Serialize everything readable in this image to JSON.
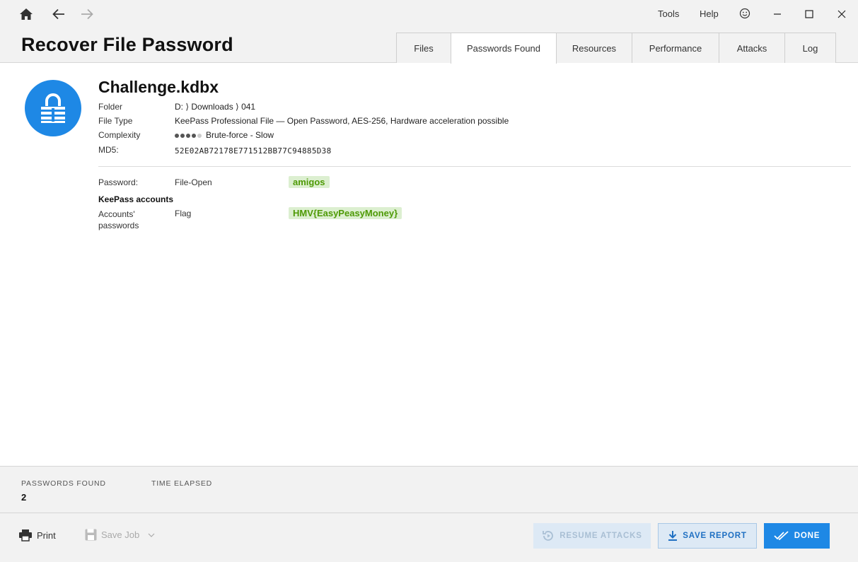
{
  "app": {
    "title": "Recover File Password"
  },
  "menu": {
    "tools": "Tools",
    "help": "Help"
  },
  "tabs": [
    {
      "label": "Files",
      "active": false
    },
    {
      "label": "Passwords Found",
      "active": true
    },
    {
      "label": "Resources",
      "active": false
    },
    {
      "label": "Performance",
      "active": false
    },
    {
      "label": "Attacks",
      "active": false
    },
    {
      "label": "Log",
      "active": false
    }
  ],
  "file": {
    "name": "Challenge.kdbx",
    "icon": "lock-icon",
    "folder_label": "Folder",
    "folder_value": "D: ⟩ Downloads ⟩ 041",
    "type_label": "File Type",
    "type_value": "KeePass Professional File — Open Password, AES-256, Hardware acceleration possible",
    "complexity_label": "Complexity",
    "complexity_level": 4,
    "complexity_max": 5,
    "complexity_value": "Brute-force - Slow",
    "md5_label": "MD5:",
    "md5_value": "52E02AB72178E771512BB77C94885D38"
  },
  "passwords": {
    "row1": {
      "label": "Password:",
      "field": "File-Open",
      "value": "amigos"
    },
    "section_heading": "KeePass accounts",
    "row2": {
      "label": "Accounts' passwords",
      "field": "Flag",
      "value": "HMV{EasyPeasyMoney}"
    }
  },
  "stats": {
    "found_label": "PASSWORDS FOUND",
    "found_value": "2",
    "elapsed_label": "TIME ELAPSED",
    "elapsed_value": ""
  },
  "footer": {
    "print_label": "Print",
    "savejob_label": "Save Job",
    "resume_label": "RESUME ATTACKS",
    "report_label": "SAVE REPORT",
    "done_label": "DONE"
  },
  "colors": {
    "accent": "#1e88e5",
    "password_bg": "#dcefd0",
    "password_text": "#4e9a06"
  }
}
